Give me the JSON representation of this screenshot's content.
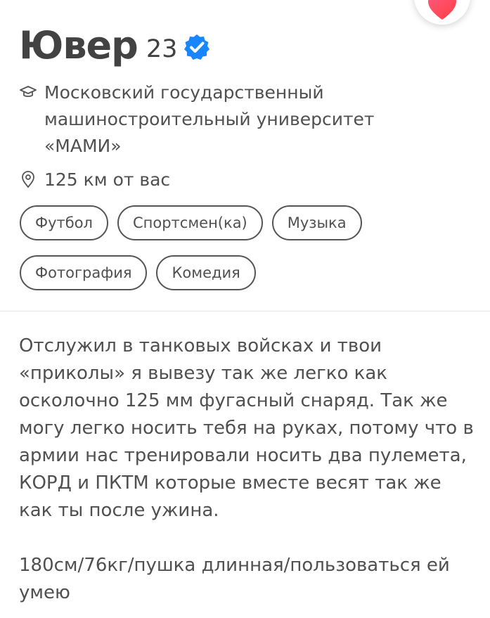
{
  "profile": {
    "name": "Ювер",
    "age": "23",
    "verified_icon": "verified-checkmark-icon",
    "school_icon": "graduation-cap-icon",
    "school": "Московский государственный машиностроительный университет «МАМИ»",
    "distance_icon": "location-pin-icon",
    "distance": "125 км от вас"
  },
  "interests": [
    "Футбол",
    "Спортсмен(ка)",
    "Музыка",
    "Фотография",
    "Комедия"
  ],
  "bio": {
    "main": "Отслужил в танковых войсках и твои «приколы» я вывезу так же легко как осколочно 125 мм фугасный снаряд. Так же могу легко носить тебя на руках, потому что в армии нас тренировали носить два пулемета, КОРД и ПКТМ которые вместе весят так же как ты после ужина.",
    "extra": "180см/76кг/пушка длинная/пользоваться ей умею"
  },
  "like_button": {
    "icon": "heart-icon"
  },
  "colors": {
    "accent": "#ff4458",
    "verified_blue": "#1786ff",
    "text": "#424242",
    "chip_border": "#555555",
    "divider": "#e6e6e6"
  }
}
